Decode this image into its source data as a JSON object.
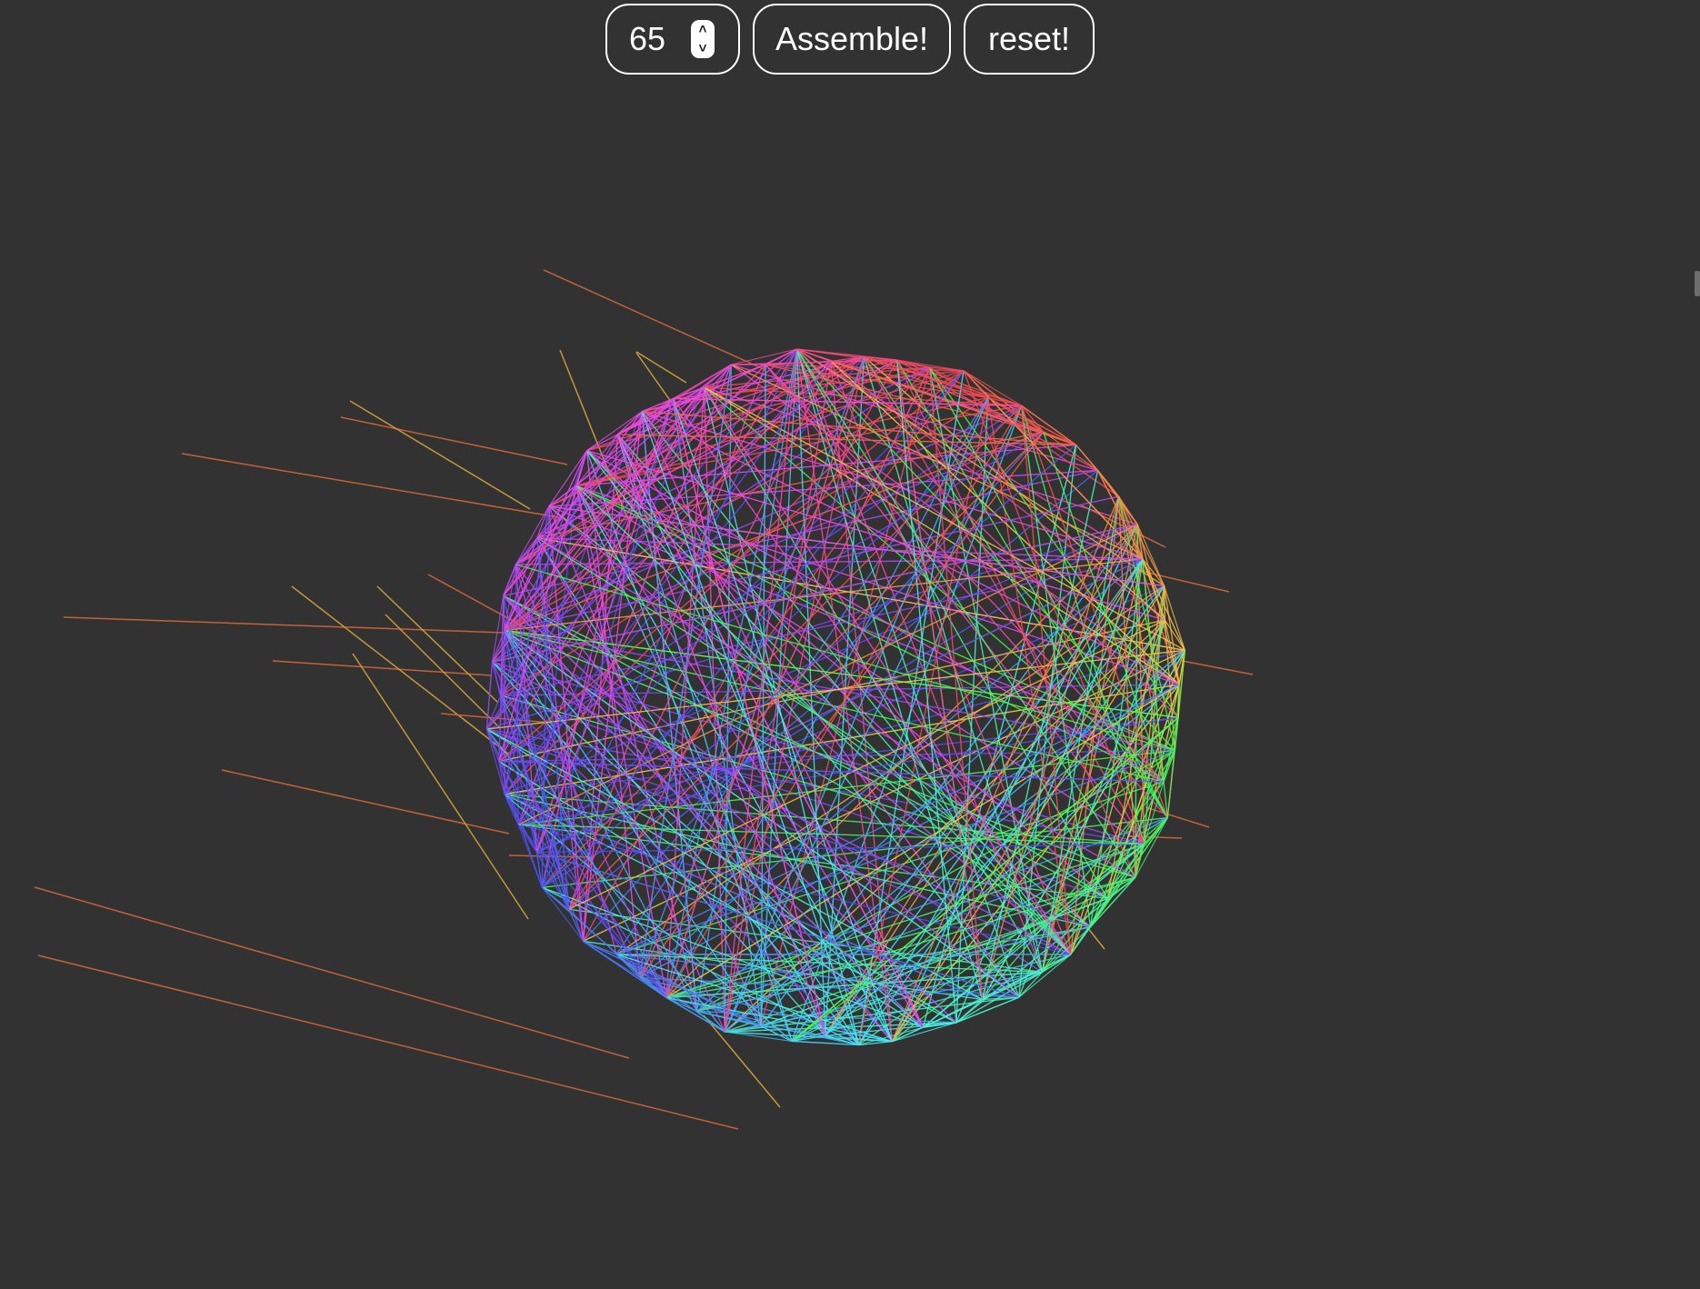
{
  "controls": {
    "count_value": "65",
    "assemble_label": "Assemble!",
    "reset_label": "reset!"
  },
  "icons": {
    "stepper": "up-down-stepper-icon"
  },
  "colors": {
    "background": "#323232",
    "button_border": "#ffffff",
    "button_text": "#ffffff",
    "stray_line_orange": "#d4663a",
    "stray_line_gold": "#d5a33a"
  },
  "visualization": {
    "points": 65
  }
}
